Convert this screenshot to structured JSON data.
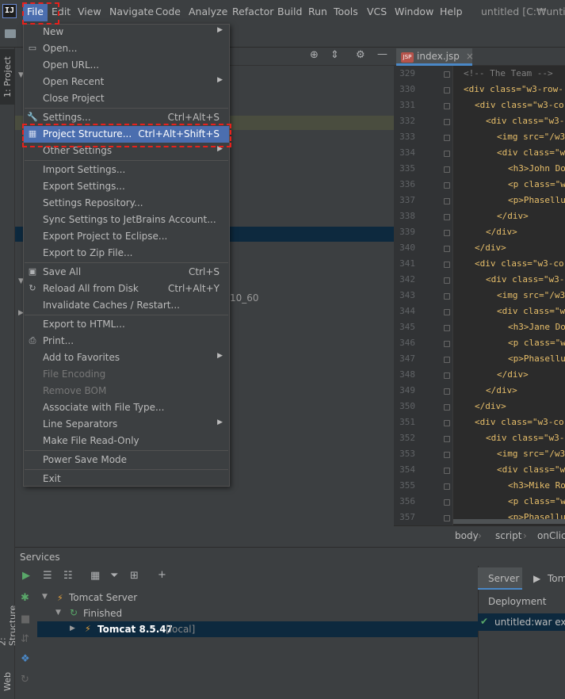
{
  "app": {
    "logo_text": "IJ",
    "window_title": "untitled [C:₩untitled"
  },
  "menubar": [
    "File",
    "Edit",
    "View",
    "Navigate",
    "Code",
    "Analyze",
    "Refactor",
    "Build",
    "Run",
    "Tools",
    "VCS",
    "Window",
    "Help"
  ],
  "left_tabs": {
    "project": "1: Project",
    "structure": "2: Structure",
    "web": "Web"
  },
  "project_tree": {
    "partial_text": "10_60"
  },
  "file_menu": {
    "new": "New",
    "open": "Open...",
    "open_url": "Open URL...",
    "open_recent": "Open Recent",
    "close_project": "Close Project",
    "settings": "Settings...",
    "settings_sc": "Ctrl+Alt+S",
    "project_structure": "Project Structure...",
    "project_structure_sc": "Ctrl+Alt+Shift+S",
    "other_settings": "Other Settings",
    "import_settings": "Import Settings...",
    "export_settings": "Export Settings...",
    "settings_repository": "Settings Repository...",
    "sync_settings": "Sync Settings to JetBrains Account...",
    "export_eclipse": "Export Project to Eclipse...",
    "export_zip": "Export to Zip File...",
    "save_all": "Save All",
    "save_all_sc": "Ctrl+S",
    "reload": "Reload All from Disk",
    "reload_sc": "Ctrl+Alt+Y",
    "invalidate": "Invalidate Caches / Restart...",
    "export_html": "Export to HTML...",
    "print": "Print...",
    "add_favorites": "Add to Favorites",
    "file_encoding": "File Encoding",
    "remove_bom": "Remove BOM",
    "associate": "Associate with File Type...",
    "line_separators": "Line Separators",
    "read_only": "Make File Read-Only",
    "power_save": "Power Save Mode",
    "exit": "Exit"
  },
  "editor": {
    "tab": "index.jsp",
    "lines": [
      {
        "n": "329",
        "text": "<!-- The Team -->",
        "indent": 0,
        "comment": true
      },
      {
        "n": "330",
        "text": "<div class=\"w3-row-",
        "indent": 0
      },
      {
        "n": "331",
        "text": "<div class=\"w3-co",
        "indent": 1
      },
      {
        "n": "332",
        "text": "<div class=\"w3-",
        "indent": 2
      },
      {
        "n": "333",
        "text": "<img src=\"/w3",
        "indent": 3
      },
      {
        "n": "334",
        "text": "<div class=\"w",
        "indent": 3
      },
      {
        "n": "335",
        "text": "<h3>John Do",
        "indent": 4
      },
      {
        "n": "336",
        "text": "<p class=\"w",
        "indent": 4
      },
      {
        "n": "337",
        "text": "<p>Phasellu",
        "indent": 4
      },
      {
        "n": "338",
        "text": "</div>",
        "indent": 3
      },
      {
        "n": "339",
        "text": "</div>",
        "indent": 2
      },
      {
        "n": "340",
        "text": "</div>",
        "indent": 1
      },
      {
        "n": "341",
        "text": "<div class=\"w3-co",
        "indent": 1
      },
      {
        "n": "342",
        "text": "<div class=\"w3-",
        "indent": 2
      },
      {
        "n": "343",
        "text": "<img src=\"/w3",
        "indent": 3
      },
      {
        "n": "344",
        "text": "<div class=\"w",
        "indent": 3
      },
      {
        "n": "345",
        "text": "<h3>Jane Do",
        "indent": 4
      },
      {
        "n": "346",
        "text": "<p class=\"w",
        "indent": 4
      },
      {
        "n": "347",
        "text": "<p>Phasellu",
        "indent": 4
      },
      {
        "n": "348",
        "text": "</div>",
        "indent": 3
      },
      {
        "n": "349",
        "text": "</div>",
        "indent": 2
      },
      {
        "n": "350",
        "text": "</div>",
        "indent": 1
      },
      {
        "n": "351",
        "text": "<div class=\"w3-co",
        "indent": 1
      },
      {
        "n": "352",
        "text": "<div class=\"w3-",
        "indent": 2
      },
      {
        "n": "353",
        "text": "<img src=\"/w3",
        "indent": 3
      },
      {
        "n": "354",
        "text": "<div class=\"w",
        "indent": 3
      },
      {
        "n": "355",
        "text": "<h3>Mike Ro",
        "indent": 4
      },
      {
        "n": "356",
        "text": "<p class=\"w",
        "indent": 4
      },
      {
        "n": "357",
        "text": "<p>Phasellu",
        "indent": 4
      }
    ]
  },
  "breadcrumbs": [
    "body",
    "script",
    "onClic"
  ],
  "services": {
    "title": "Services",
    "tree": {
      "server": "Tomcat Server",
      "finished": "Finished",
      "instance": "Tomcat 8.5.47",
      "instance_tag": "[local]"
    }
  },
  "deploy": {
    "tab_server": "Server",
    "tab_other": "Tom",
    "header": "Deployment",
    "item": "untitled:war expl"
  },
  "colors": {
    "accent": "#4b6eaf",
    "highlight_box": "#e8211c",
    "background": "#3c3f41",
    "editor_bg": "#2b2b2b"
  }
}
